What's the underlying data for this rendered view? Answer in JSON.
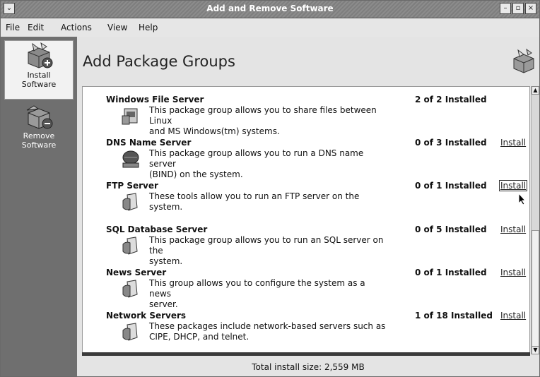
{
  "window": {
    "title": "Add and Remove Software"
  },
  "menu": [
    "File",
    "Edit",
    "Actions",
    "View",
    "Help"
  ],
  "sidebar": {
    "items": [
      {
        "label_line1": "Install",
        "label_line2": "Software",
        "icon": "install-icon"
      },
      {
        "label_line1": "Remove",
        "label_line2": "Software",
        "icon": "remove-icon"
      }
    ]
  },
  "header": {
    "title": "Add Package Groups"
  },
  "groups": [
    {
      "name": "Windows File Server",
      "status": "2 of 2 Installed",
      "install": "",
      "desc1": "This package group allows you to share files between Linux",
      "desc2": "and MS Windows(tm) systems.",
      "icon": "file-server-icon"
    },
    {
      "name": "DNS Name Server",
      "status": "0 of 3 Installed",
      "install": "Install",
      "desc1": "This package group allows you to run a DNS name server",
      "desc2": "(BIND) on the system.",
      "icon": "dns-server-icon"
    },
    {
      "name": "FTP Server",
      "status": "0 of 1 Installed",
      "install": "Install",
      "desc1": "These tools allow you to run an FTP server on the system.",
      "desc2": "",
      "icon": "server-icon"
    },
    {
      "name": "SQL Database Server",
      "status": "0 of 5 Installed",
      "install": "Install",
      "desc1": "This package group allows you to run an SQL server on the",
      "desc2": "system.",
      "icon": "server-icon"
    },
    {
      "name": "News Server",
      "status": "0 of 1 Installed",
      "install": "Install",
      "desc1": "This group allows you to configure the system as a news",
      "desc2": "server.",
      "icon": "server-icon"
    },
    {
      "name": "Network Servers",
      "status": "1 of 18 Installed",
      "install": "Install",
      "desc1": "These packages include network-based servers such as",
      "desc2": "CIPE, DHCP, and telnet.",
      "icon": "server-icon"
    }
  ],
  "footer": {
    "total": "Total install size: 2,559 MB"
  }
}
